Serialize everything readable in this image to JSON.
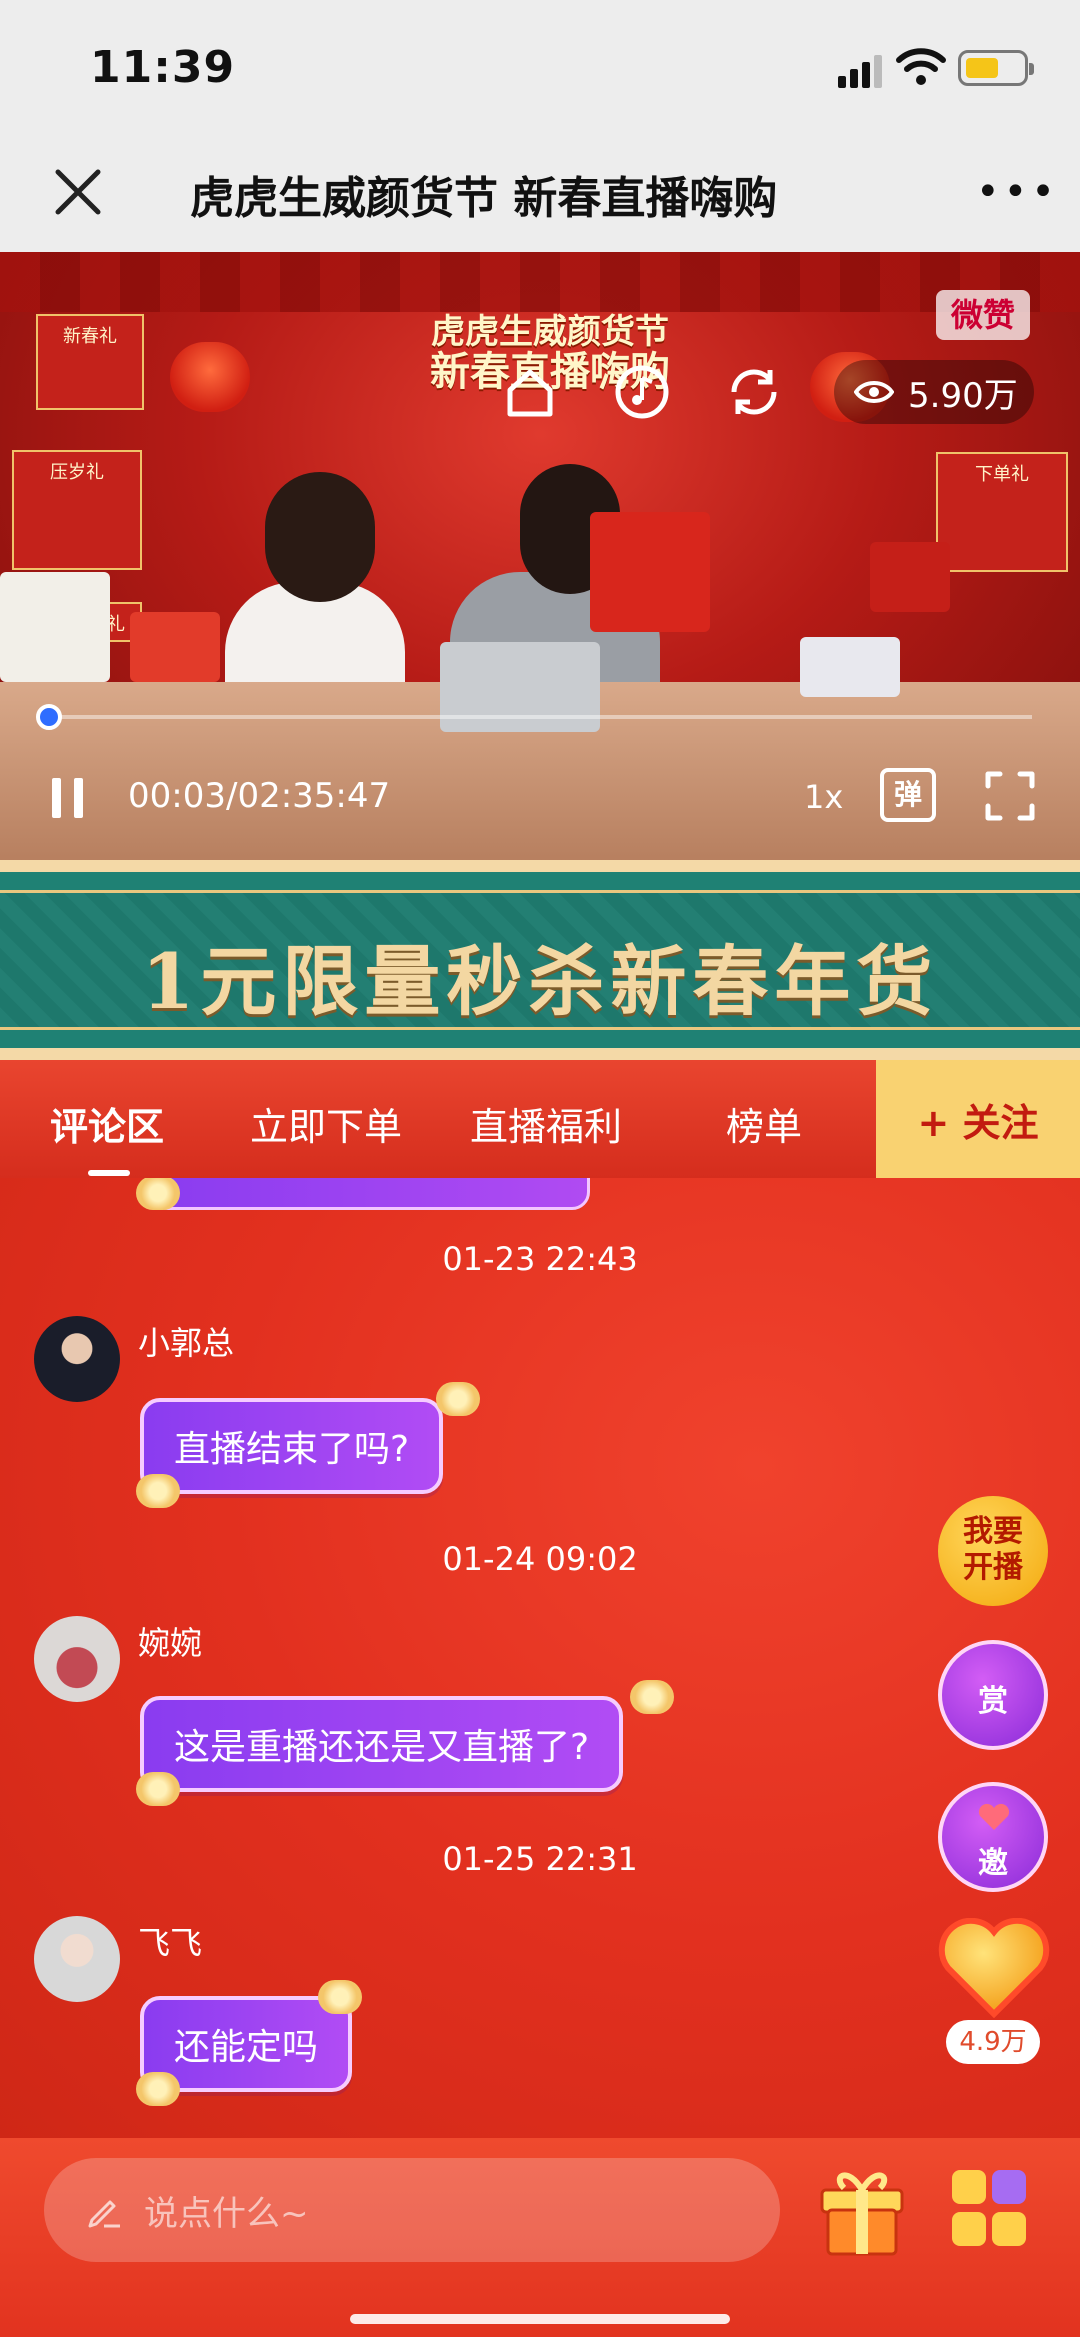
{
  "status_bar": {
    "time": "11:39"
  },
  "nav": {
    "title": "虎虎生威颜货节 新春直播嗨购",
    "more": "•••"
  },
  "video": {
    "banner_line1": "虎虎生威颜货节",
    "banner_line2": "新春直播嗨购",
    "watermark": "微赞",
    "views": "5.90万",
    "current_time": "00:03",
    "duration": "02:35:47",
    "time_display": "00:03/02:35:47",
    "speed": "1x",
    "danmu": "弹",
    "board_left_top": "新春礼",
    "board_left_mid": "压岁礼",
    "board_left_low": "额礼",
    "board_right": "下单礼",
    "progress_fraction": 0.0003
  },
  "promo": {
    "text": "1元限量秒杀新春年货"
  },
  "tabs": [
    {
      "label": "评论区",
      "active": true
    },
    {
      "label": "立即下单",
      "active": false
    },
    {
      "label": "直播福利",
      "active": false
    },
    {
      "label": "榜单",
      "active": false
    }
  ],
  "follow_button": "+ 关注",
  "comments": [
    {
      "timestamp": "01-23 22:43",
      "user": "小郭总",
      "text": "直播结束了吗?"
    },
    {
      "timestamp": "01-24 09:02",
      "user": "婉婉",
      "text": "这是重播还还是又直播了?"
    },
    {
      "timestamp": "01-25 22:31",
      "user": "飞飞",
      "text": "还能定吗"
    }
  ],
  "side_buttons": {
    "live": "我要开播",
    "live_line1": "我要",
    "live_line2": "开播",
    "reward": "赏",
    "invite": "邀",
    "likes": "4.9万"
  },
  "bottom": {
    "placeholder": "说点什么~"
  },
  "colors": {
    "accent_red": "#e2331f",
    "bubble_purple": "#8a3cf0",
    "promo_green": "#1f8174",
    "follow_gold": "#f9d271",
    "progress_blue": "#2f6dff"
  }
}
